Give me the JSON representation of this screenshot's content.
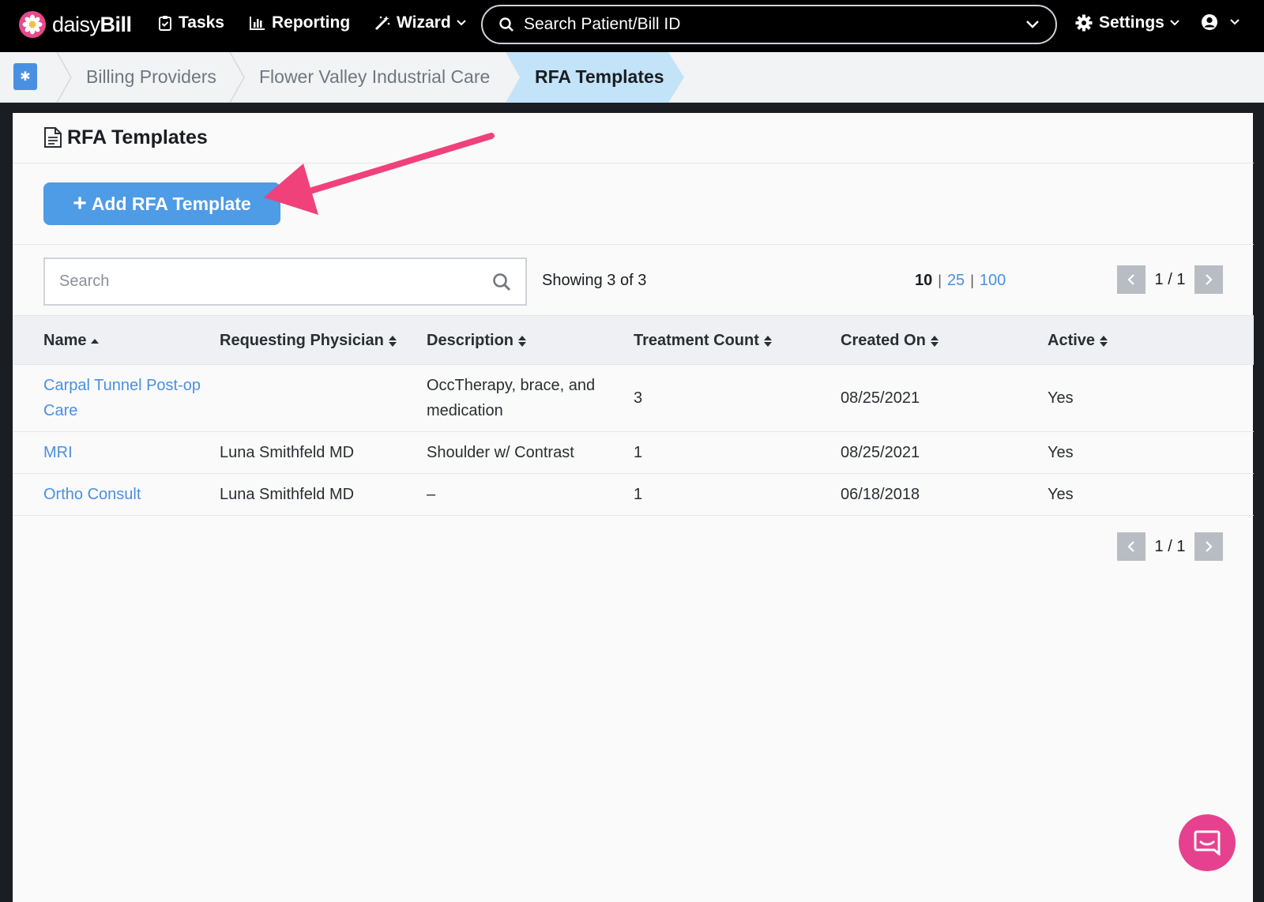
{
  "brand": {
    "name_light": "daisy",
    "name_bold": "Bill"
  },
  "nav": {
    "tasks": "Tasks",
    "reporting": "Reporting",
    "wizard": "Wizard",
    "search_placeholder": "Search Patient/Bill ID",
    "settings": "Settings"
  },
  "breadcrumb": {
    "items": [
      "Billing Providers",
      "Flower Valley Industrial Care"
    ],
    "active": "RFA Templates"
  },
  "panel": {
    "title": "RFA Templates",
    "add_button": "Add RFA Template",
    "search_placeholder": "Search",
    "showing": "Showing 3 of 3",
    "per_page": {
      "current": "10",
      "options": [
        "25",
        "100"
      ]
    },
    "pager_top": "1 / 1",
    "pager_bottom": "1 / 1"
  },
  "table": {
    "columns": [
      "Name",
      "Requesting Physician",
      "Description",
      "Treatment Count",
      "Created On",
      "Active"
    ],
    "rows": [
      {
        "name_line1": "Carpal Tunnel Post-op",
        "name_line2": "Care",
        "physician": "",
        "desc_line1": "OccTherapy, brace, and",
        "desc_line2": "medication",
        "count": "3",
        "created": "08/25/2021",
        "active": "Yes"
      },
      {
        "name": "MRI",
        "physician": "Luna Smithfeld MD",
        "desc": "Shoulder w/ Contrast",
        "count": "1",
        "created": "08/25/2021",
        "active": "Yes"
      },
      {
        "name": "Ortho Consult",
        "physician": "Luna Smithfeld MD",
        "desc": "–",
        "count": "1",
        "created": "06/18/2018",
        "active": "Yes"
      }
    ]
  },
  "colors": {
    "accent": "#4a90e2",
    "button": "#4e9be6",
    "annotation_arrow": "#f0417a",
    "chat": "#e6418f"
  }
}
